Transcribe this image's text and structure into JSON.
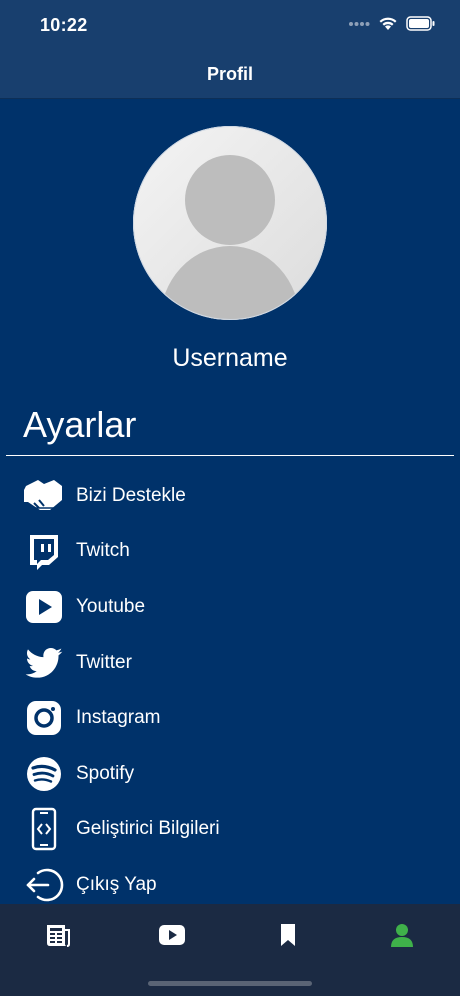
{
  "status": {
    "time": "10:22"
  },
  "nav": {
    "title": "Profil"
  },
  "profile": {
    "username": "Username"
  },
  "settings": {
    "title": "Ayarlar",
    "items": [
      {
        "label": "Bizi Destekle",
        "icon": "handshake-icon"
      },
      {
        "label": "Twitch",
        "icon": "twitch-icon"
      },
      {
        "label": "Youtube",
        "icon": "youtube-icon"
      },
      {
        "label": "Twitter",
        "icon": "twitter-icon"
      },
      {
        "label": "Instagram",
        "icon": "instagram-icon"
      },
      {
        "label": "Spotify",
        "icon": "spotify-icon"
      },
      {
        "label": "Geliştirici Bilgileri",
        "icon": "developer-phone-icon"
      },
      {
        "label": "Çıkış Yap",
        "icon": "logout-icon"
      }
    ]
  },
  "tabbar": {
    "tabs": [
      {
        "icon": "news-icon",
        "active": false
      },
      {
        "icon": "video-icon",
        "active": false
      },
      {
        "icon": "bookmark-icon",
        "active": false
      },
      {
        "icon": "profile-icon",
        "active": true
      }
    ],
    "active_color": "#3fb14a",
    "inactive_color": "#ffffff"
  },
  "colors": {
    "background": "#00326a",
    "header": "#183f6e",
    "tabbar": "#1b2a43"
  }
}
